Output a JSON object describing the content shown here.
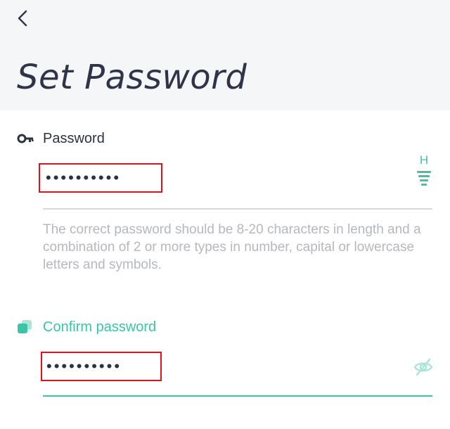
{
  "header": {
    "title": "Set Password"
  },
  "password": {
    "label": "Password",
    "value": "••••••••••",
    "strength_letter": "H",
    "hint": "The correct password should be 8-20 characters in length and a combination of 2 or more types in number, capital or lowercase letters and symbols."
  },
  "confirm": {
    "label": "Confirm password",
    "value": "••••••••••"
  },
  "icons": {
    "back": "back-arrow-icon",
    "key": "key-icon",
    "confirm": "confirm-squares-icon",
    "strength": "strength-meter-icon",
    "visibility": "eye-off-icon"
  },
  "colors": {
    "accent": "#3cc4a6",
    "text": "#2c3143",
    "hint": "#b6b8bf",
    "highlight_box": "#e0121e",
    "header_bg": "#f5f6f8"
  }
}
